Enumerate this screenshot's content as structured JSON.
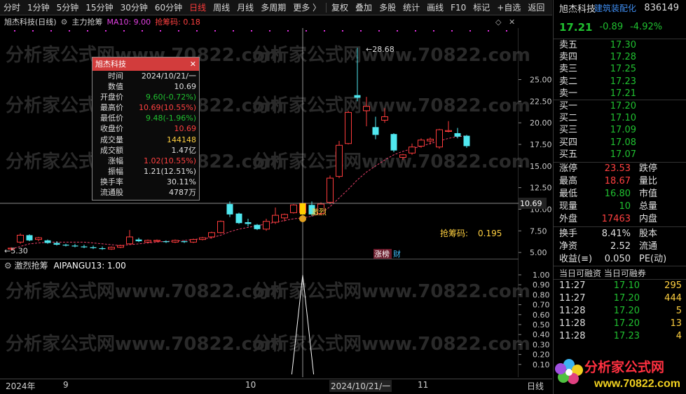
{
  "toolbar": {
    "items": [
      "分时",
      "1分钟",
      "5分钟",
      "15分钟",
      "30分钟",
      "60分钟",
      "日线",
      "周线",
      "月线",
      "多周期",
      "更多 〉",
      "复权",
      "叠加",
      "多股",
      "统计",
      "画线",
      "F10",
      "标记",
      "+自选",
      "返回"
    ],
    "active_index": 6
  },
  "subtitle": {
    "stock": "旭杰科技(日线)",
    "indicator": "主力抢筹",
    "ma": "MA10: 9.00",
    "chip": "抢筹码: 0.18"
  },
  "tooltip": {
    "title": "旭杰科技",
    "rows": [
      {
        "k": "时间",
        "v": "2024/10/21/一",
        "c": "w"
      },
      {
        "k": "数值",
        "v": "10.69",
        "c": "w"
      },
      {
        "k": "开盘价",
        "v": "9.60(-0.72%)",
        "c": "g"
      },
      {
        "k": "最高价",
        "v": "10.69(10.55%)",
        "c": "r2"
      },
      {
        "k": "最低价",
        "v": "9.48(-1.96%)",
        "c": "g"
      },
      {
        "k": "收盘价",
        "v": "10.69",
        "c": "r2"
      },
      {
        "k": "成交量",
        "v": "144148",
        "c": "y"
      },
      {
        "k": "成交额",
        "v": "1.47亿",
        "c": "w"
      },
      {
        "k": "涨幅",
        "v": "1.02(10.55%)",
        "c": "r2"
      },
      {
        "k": "振幅",
        "v": "1.21(12.51%)",
        "c": "w"
      },
      {
        "k": "换手率",
        "v": "30.11%",
        "c": "w"
      },
      {
        "k": "流通股",
        "v": "4787万",
        "c": "w"
      }
    ]
  },
  "main_chart": {
    "y_ticks": [
      "25.00",
      "22.50",
      "20.00",
      "17.50",
      "15.00",
      "12.50",
      "10.00",
      "7.50",
      "5.00"
    ],
    "crosshair_value": "10.69",
    "high_label": "28.68",
    "low_label": "5.30",
    "signal_label": "激烈",
    "chip_label": "抢筹码:",
    "chip_value": "0.195",
    "badge_zb": "涨榜",
    "badge_cai": "财"
  },
  "sub_chart": {
    "title": "激烈抢筹",
    "series": "AIPANGU13: 1.00",
    "y_ticks": [
      "1.00",
      "0.90",
      "0.80",
      "0.70",
      "0.60",
      "0.50",
      "0.40",
      "0.30",
      "0.20",
      "0.10"
    ]
  },
  "x_axis": {
    "labels": [
      "2024年",
      "9",
      "10",
      "2024/10/21/一",
      "11"
    ],
    "right": "日线"
  },
  "chart_data": {
    "type": "candlestick",
    "ylim": [
      4.2,
      29.5
    ],
    "candles": [
      [
        5.4,
        5.6,
        5.2,
        5.5
      ],
      [
        6.2,
        7.2,
        6.0,
        7.0
      ],
      [
        7.0,
        7.1,
        6.3,
        6.4
      ],
      [
        6.5,
        6.8,
        6.3,
        6.7
      ],
      [
        6.4,
        6.5,
        6.0,
        6.1
      ],
      [
        6.1,
        6.3,
        5.8,
        5.9
      ],
      [
        5.9,
        6.0,
        5.7,
        5.8
      ],
      [
        5.8,
        6.0,
        5.6,
        5.7
      ],
      [
        5.7,
        5.9,
        5.5,
        5.6
      ],
      [
        5.6,
        5.8,
        5.4,
        5.5
      ],
      [
        5.5,
        5.7,
        5.3,
        5.4
      ],
      [
        5.4,
        5.7,
        5.3,
        5.6
      ],
      [
        5.6,
        5.9,
        5.5,
        5.8
      ],
      [
        6.0,
        7.6,
        5.9,
        6.8
      ],
      [
        6.5,
        6.7,
        6.2,
        6.3
      ],
      [
        6.2,
        6.5,
        6.1,
        6.4
      ],
      [
        6.3,
        6.5,
        6.2,
        6.4
      ],
      [
        6.3,
        6.4,
        6.1,
        6.2
      ],
      [
        6.2,
        6.5,
        6.1,
        6.4
      ],
      [
        6.3,
        6.4,
        6.1,
        6.2
      ],
      [
        6.2,
        6.6,
        6.1,
        6.5
      ],
      [
        6.5,
        6.8,
        6.4,
        6.7
      ],
      [
        6.8,
        7.4,
        6.6,
        7.3
      ],
      [
        7.3,
        8.7,
        7.2,
        8.6
      ],
      [
        10.6,
        10.9,
        9.1,
        9.4
      ],
      [
        9.5,
        9.6,
        8.3,
        8.4
      ],
      [
        8.5,
        8.9,
        8.0,
        8.3
      ],
      [
        8.2,
        8.3,
        7.6,
        7.7
      ],
      [
        7.7,
        8.9,
        7.5,
        8.6
      ],
      [
        8.5,
        10.2,
        8.3,
        9.3
      ],
      [
        9.0,
        9.5,
        8.6,
        9.4
      ],
      [
        9.6,
        10.6,
        9.5,
        10.5
      ],
      [
        9.6,
        10.69,
        9.48,
        10.69
      ],
      [
        10.5,
        10.9,
        9.2,
        9.4
      ],
      [
        9.5,
        10.8,
        9.3,
        10.6
      ],
      [
        10.8,
        13.9,
        10.6,
        13.6
      ],
      [
        13.8,
        17.9,
        13.6,
        17.4
      ],
      [
        17.6,
        21.4,
        17.5,
        21.2
      ],
      [
        23.2,
        28.68,
        22.5,
        22.9
      ],
      [
        21.4,
        23.0,
        19.6,
        21.9
      ],
      [
        19.5,
        20.7,
        18.1,
        18.6
      ],
      [
        20.3,
        21.7,
        20.0,
        20.7
      ],
      [
        18.7,
        18.8,
        16.6,
        16.8
      ],
      [
        16.0,
        16.4,
        15.7,
        16.3
      ],
      [
        16.5,
        17.6,
        16.3,
        17.2
      ],
      [
        17.3,
        18.2,
        17.1,
        18.0
      ],
      [
        17.9,
        18.3,
        17.5,
        18.1
      ],
      [
        17.2,
        19.3,
        17.0,
        19.2
      ],
      [
        19.0,
        20.2,
        18.9,
        19.1
      ],
      [
        18.8,
        19.4,
        18.2,
        18.4
      ],
      [
        18.5,
        18.6,
        17.1,
        17.3
      ]
    ],
    "ma10": [
      5.4,
      5.7,
      6.0,
      6.1,
      6.2,
      6.2,
      6.2,
      6.2,
      6.2,
      6.1,
      6.0,
      5.9,
      5.8,
      5.9,
      6.0,
      6.1,
      6.2,
      6.3,
      6.3,
      6.4,
      6.5,
      6.6,
      6.7,
      7.0,
      7.4,
      7.7,
      7.9,
      8.1,
      8.3,
      8.5,
      8.7,
      8.9,
      9.0,
      9.2,
      9.5,
      10.3,
      11.3,
      12.3,
      13.4,
      14.3,
      15.0,
      15.7,
      16.3,
      16.7,
      17.0,
      17.3,
      17.6,
      17.9,
      18.2,
      18.4,
      18.5
    ],
    "signal": {
      "type": "line",
      "x": [
        31,
        32,
        33
      ],
      "values": [
        0,
        1,
        0
      ]
    }
  }
}
